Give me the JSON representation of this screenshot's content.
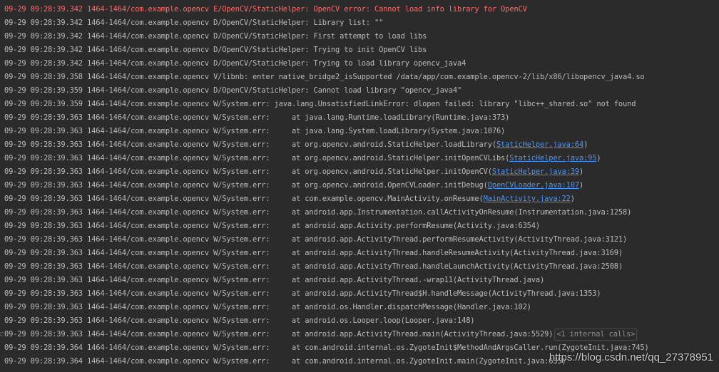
{
  "log_lines": [
    {
      "type": "error",
      "text": "09-29 09:28:39.342 1464-1464/com.example.opencv E/OpenCV/StaticHelper: OpenCV error: Cannot load info library for OpenCV"
    },
    {
      "type": "debug",
      "text": "09-29 09:28:39.342 1464-1464/com.example.opencv D/OpenCV/StaticHelper: Library list: \"\""
    },
    {
      "type": "debug",
      "text": "09-29 09:28:39.342 1464-1464/com.example.opencv D/OpenCV/StaticHelper: First attempt to load libs"
    },
    {
      "type": "debug",
      "text": "09-29 09:28:39.342 1464-1464/com.example.opencv D/OpenCV/StaticHelper: Trying to init OpenCV libs"
    },
    {
      "type": "debug",
      "text": "09-29 09:28:39.342 1464-1464/com.example.opencv D/OpenCV/StaticHelper: Trying to load library opencv_java4"
    },
    {
      "type": "verbose",
      "text": "09-29 09:28:39.358 1464-1464/com.example.opencv V/libnb: enter native_bridge2_isSupported /data/app/com.example.opencv-2/lib/x86/libopencv_java4.so"
    },
    {
      "type": "debug",
      "text": "09-29 09:28:39.359 1464-1464/com.example.opencv D/OpenCV/StaticHelper: Cannot load library \"opencv_java4\""
    },
    {
      "type": "warn",
      "text": "09-29 09:28:39.359 1464-1464/com.example.opencv W/System.err: java.lang.UnsatisfiedLinkError: dlopen failed: library \"libc++_shared.so\" not found"
    },
    {
      "type": "warn",
      "text": "09-29 09:28:39.363 1464-1464/com.example.opencv W/System.err:     at java.lang.Runtime.loadLibrary(Runtime.java:373)"
    },
    {
      "type": "warn",
      "text": "09-29 09:28:39.363 1464-1464/com.example.opencv W/System.err:     at java.lang.System.loadLibrary(System.java:1076)"
    },
    {
      "type": "warn",
      "text": "09-29 09:28:39.363 1464-1464/com.example.opencv W/System.err:     at org.opencv.android.StaticHelper.loadLibrary(",
      "link": "StaticHelper.java:64",
      "after": ")"
    },
    {
      "type": "warn",
      "text": "09-29 09:28:39.363 1464-1464/com.example.opencv W/System.err:     at org.opencv.android.StaticHelper.initOpenCVLibs(",
      "link": "StaticHelper.java:95",
      "after": ")"
    },
    {
      "type": "warn",
      "text": "09-29 09:28:39.363 1464-1464/com.example.opencv W/System.err:     at org.opencv.android.StaticHelper.initOpenCV(",
      "link": "StaticHelper.java:39",
      "after": ")"
    },
    {
      "type": "warn",
      "text": "09-29 09:28:39.363 1464-1464/com.example.opencv W/System.err:     at org.opencv.android.OpenCVLoader.initDebug(",
      "link": "OpenCVLoader.java:107",
      "after": ")"
    },
    {
      "type": "warn",
      "text": "09-29 09:28:39.363 1464-1464/com.example.opencv W/System.err:     at com.example.opencv.MainActivity.onResume(",
      "link": "MainActivity.java:22",
      "after": ")"
    },
    {
      "type": "warn",
      "text": "09-29 09:28:39.363 1464-1464/com.example.opencv W/System.err:     at android.app.Instrumentation.callActivityOnResume(Instrumentation.java:1258)"
    },
    {
      "type": "warn",
      "text": "09-29 09:28:39.363 1464-1464/com.example.opencv W/System.err:     at android.app.Activity.performResume(Activity.java:6354)"
    },
    {
      "type": "warn",
      "text": "09-29 09:28:39.363 1464-1464/com.example.opencv W/System.err:     at android.app.ActivityThread.performResumeActivity(ActivityThread.java:3121)"
    },
    {
      "type": "warn",
      "text": "09-29 09:28:39.363 1464-1464/com.example.opencv W/System.err:     at android.app.ActivityThread.handleResumeActivity(ActivityThread.java:3169)"
    },
    {
      "type": "warn",
      "text": "09-29 09:28:39.363 1464-1464/com.example.opencv W/System.err:     at android.app.ActivityThread.handleLaunchActivity(ActivityThread.java:2508)"
    },
    {
      "type": "warn",
      "text": "09-29 09:28:39.363 1464-1464/com.example.opencv W/System.err:     at android.app.ActivityThread.-wrap11(ActivityThread.java)"
    },
    {
      "type": "warn",
      "text": "09-29 09:28:39.363 1464-1464/com.example.opencv W/System.err:     at android.app.ActivityThread$H.handleMessage(ActivityThread.java:1353)"
    },
    {
      "type": "warn",
      "text": "09-29 09:28:39.363 1464-1464/com.example.opencv W/System.err:     at android.os.Handler.dispatchMessage(Handler.java:102)"
    },
    {
      "type": "warn",
      "text": "09-29 09:28:39.363 1464-1464/com.example.opencv W/System.err:     at android.os.Looper.loop(Looper.java:148)"
    },
    {
      "type": "warn",
      "text": "09-29 09:28:39.363 1464-1464/com.example.opencv W/System.err:     at android.app.ActivityThread.main(ActivityThread.java:5529)",
      "fold": "<1 internal calls>"
    },
    {
      "type": "warn",
      "text": "09-29 09:28:39.364 1464-1464/com.example.opencv W/System.err:     at com.android.internal.os.ZygoteInit$MethodAndArgsCaller.run(ZygoteInit.java:745)"
    },
    {
      "type": "warn",
      "text": "09-29 09:28:39.364 1464-1464/com.example.opencv W/System.err:     at com.android.internal.os.ZygoteInit.main(ZygoteInit.java:635)"
    }
  ],
  "watermark": "https://blog.csdn.net/qq_27378951",
  "colors": {
    "background": "#2b2b2b",
    "error": "#ff6b68",
    "normal": "#bbbbbb",
    "link": "#5394ec"
  }
}
